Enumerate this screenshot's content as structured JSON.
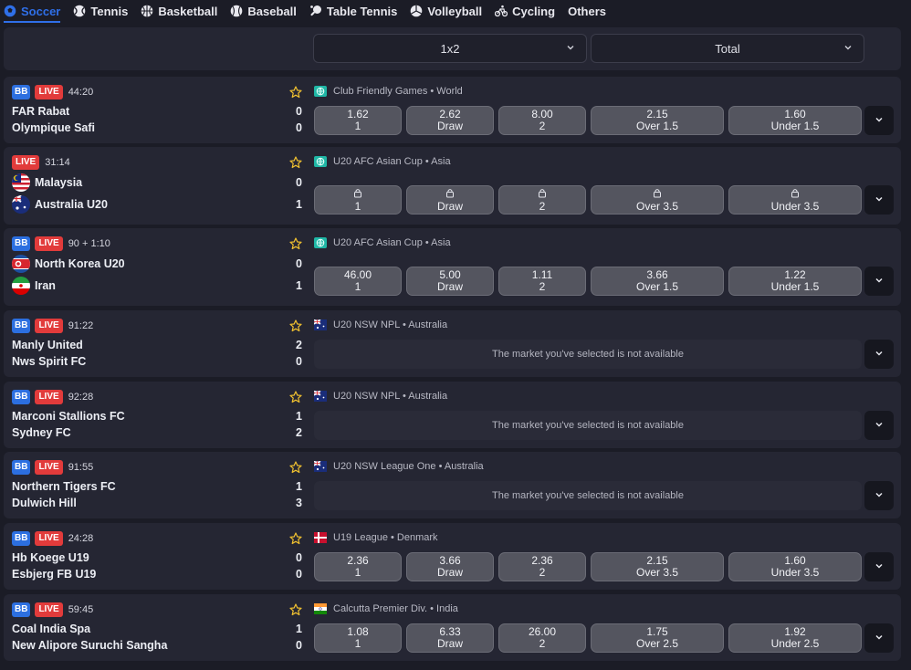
{
  "tabs": [
    {
      "label": "Soccer",
      "icon": "soccer-ball-icon",
      "active": true
    },
    {
      "label": "Tennis",
      "icon": "tennis-ball-icon"
    },
    {
      "label": "Basketball",
      "icon": "basketball-icon"
    },
    {
      "label": "Baseball",
      "icon": "baseball-icon"
    },
    {
      "label": "Table Tennis",
      "icon": "table-tennis-icon"
    },
    {
      "label": "Volleyball",
      "icon": "volleyball-icon"
    },
    {
      "label": "Cycling",
      "icon": "cycling-icon"
    },
    {
      "label": "Others",
      "icon": ""
    }
  ],
  "markets": {
    "primary": "1x2",
    "secondary": "Total"
  },
  "labels": {
    "bb": "BB",
    "live": "LIVE",
    "unavailable": "The market you've selected is not available"
  },
  "colors": {
    "accent": "#2f6fe8",
    "live": "#e23b3b",
    "bb": "#2c6fe0"
  },
  "matches": [
    {
      "bb": true,
      "time": "44:20",
      "league": "Club Friendly Games • World",
      "league_icon": "globe-icon",
      "home": "FAR Rabat",
      "away": "Olympique Safi",
      "home_score": "0",
      "away_score": "0",
      "odds": [
        {
          "value": "1.62",
          "label": "1"
        },
        {
          "value": "2.62",
          "label": "Draw"
        },
        {
          "value": "8.00",
          "label": "2"
        },
        {
          "value": "2.15",
          "label": "Over 1.5"
        },
        {
          "value": "1.60",
          "label": "Under 1.5"
        }
      ]
    },
    {
      "bb": false,
      "time": "31:14",
      "league": "U20 AFC Asian Cup • Asia",
      "league_icon": "globe-icon",
      "home": "Malaysia",
      "away": "Australia U20",
      "home_score": "0",
      "away_score": "1",
      "home_flag": "malaysia",
      "away_flag": "australia",
      "locked": true,
      "odds": [
        {
          "value": "",
          "label": "1"
        },
        {
          "value": "",
          "label": "Draw"
        },
        {
          "value": "",
          "label": "2"
        },
        {
          "value": "",
          "label": "Over 3.5"
        },
        {
          "value": "",
          "label": "Under 3.5"
        }
      ]
    },
    {
      "bb": true,
      "time": "90 + 1:10",
      "league": "U20 AFC Asian Cup • Asia",
      "league_icon": "globe-icon",
      "home": "North Korea U20",
      "away": "Iran",
      "home_score": "0",
      "away_score": "1",
      "home_flag": "northkorea",
      "away_flag": "iran",
      "odds": [
        {
          "value": "46.00",
          "label": "1"
        },
        {
          "value": "5.00",
          "label": "Draw"
        },
        {
          "value": "1.11",
          "label": "2"
        },
        {
          "value": "3.66",
          "label": "Over 1.5"
        },
        {
          "value": "1.22",
          "label": "Under 1.5"
        }
      ]
    },
    {
      "bb": true,
      "time": "91:22",
      "league": "U20 NSW NPL • Australia",
      "league_icon": "australia-flag-icon",
      "home": "Manly United",
      "away": "Nws Spirit FC",
      "home_score": "2",
      "away_score": "0",
      "unavailable": true
    },
    {
      "bb": true,
      "time": "92:28",
      "league": "U20 NSW NPL • Australia",
      "league_icon": "australia-flag-icon",
      "home": "Marconi Stallions FC",
      "away": "Sydney FC",
      "home_score": "1",
      "away_score": "2",
      "unavailable": true
    },
    {
      "bb": true,
      "time": "91:55",
      "league": "U20 NSW League One • Australia",
      "league_icon": "australia-flag-icon",
      "home": "Northern Tigers FC",
      "away": "Dulwich Hill",
      "home_score": "1",
      "away_score": "3",
      "unavailable": true
    },
    {
      "bb": true,
      "time": "24:28",
      "league": "U19 League • Denmark",
      "league_icon": "denmark-flag-icon",
      "home": "Hb Koege U19",
      "away": "Esbjerg FB U19",
      "home_score": "0",
      "away_score": "0",
      "odds": [
        {
          "value": "2.36",
          "label": "1"
        },
        {
          "value": "3.66",
          "label": "Draw"
        },
        {
          "value": "2.36",
          "label": "2"
        },
        {
          "value": "2.15",
          "label": "Over 3.5"
        },
        {
          "value": "1.60",
          "label": "Under 3.5"
        }
      ]
    },
    {
      "bb": true,
      "time": "59:45",
      "league": "Calcutta Premier Div. • India",
      "league_icon": "india-flag-icon",
      "home": "Coal India Spa",
      "away": "New Alipore Suruchi Sangha",
      "home_score": "1",
      "away_score": "0",
      "odds": [
        {
          "value": "1.08",
          "label": "1"
        },
        {
          "value": "6.33",
          "label": "Draw"
        },
        {
          "value": "26.00",
          "label": "2"
        },
        {
          "value": "1.75",
          "label": "Over 2.5"
        },
        {
          "value": "1.92",
          "label": "Under 2.5"
        }
      ]
    }
  ]
}
